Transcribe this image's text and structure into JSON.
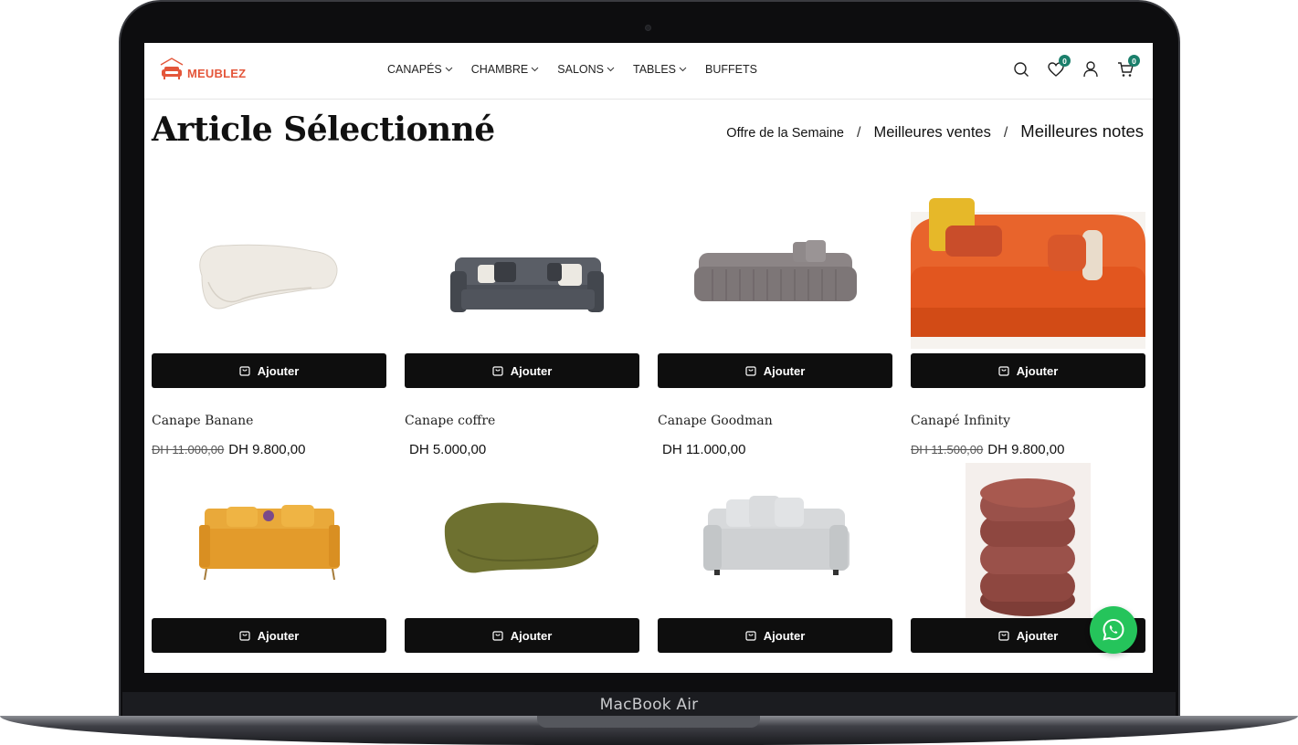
{
  "device": {
    "label": "MacBook Air"
  },
  "brand": {
    "name": "MEUBLEZ",
    "color": "#e4563a"
  },
  "nav": {
    "items": [
      {
        "label": "CANAPÉS",
        "has_dropdown": true
      },
      {
        "label": "CHAMBRE",
        "has_dropdown": true
      },
      {
        "label": "SALONS",
        "has_dropdown": true
      },
      {
        "label": "TABLES",
        "has_dropdown": true
      },
      {
        "label": "BUFFETS",
        "has_dropdown": false
      }
    ]
  },
  "header_icons": {
    "search": "search-icon",
    "wishlist": {
      "icon": "heart-icon",
      "count": "0"
    },
    "account": "user-icon",
    "cart": {
      "icon": "cart-icon",
      "count": "0"
    },
    "badge_color": "#1b7f6b"
  },
  "section": {
    "title": "Article Sélectionné",
    "filters": [
      "Offre de la Semaine",
      "Meilleures ventes",
      "Meilleures notes"
    ],
    "separator": "/"
  },
  "add_label": "Ajouter",
  "products": [
    {
      "name": "Canape Banane",
      "old_price": "DH 11.000,00",
      "price": "DH 9.800,00"
    },
    {
      "name": "Canape coffre",
      "old_price": "",
      "price": "DH 5.000,00"
    },
    {
      "name": "Canape Goodman",
      "old_price": "",
      "price": "DH 11.000,00"
    },
    {
      "name": "Canapé Infinity",
      "old_price": "DH 11.500,00",
      "price": "DH 9.800,00"
    },
    {
      "name": "",
      "old_price": "",
      "price": ""
    },
    {
      "name": "",
      "old_price": "",
      "price": ""
    },
    {
      "name": "",
      "old_price": "",
      "price": ""
    },
    {
      "name": "",
      "old_price": "",
      "price": ""
    }
  ],
  "whatsapp": {
    "icon": "whatsapp-icon",
    "color": "#25c45b"
  }
}
